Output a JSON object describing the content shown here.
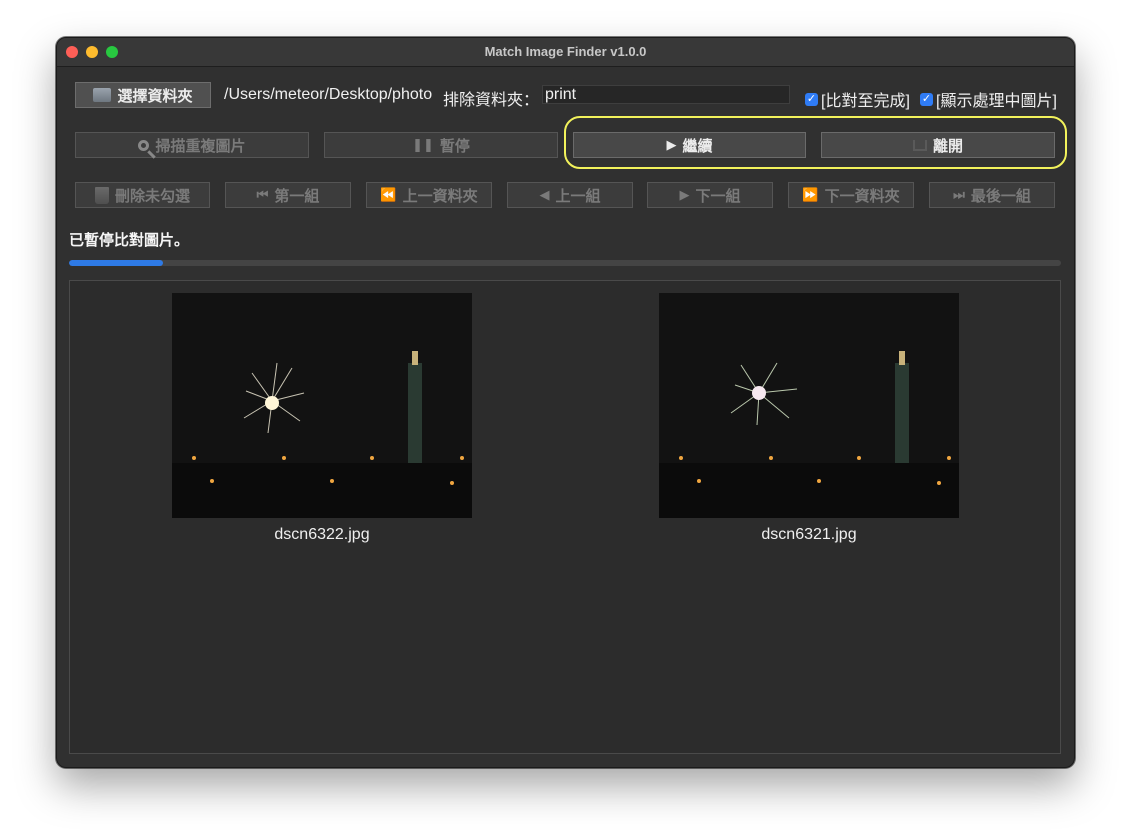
{
  "window": {
    "title": "Match Image Finder v1.0.0"
  },
  "toolbar": {
    "choose_folder_label": "選擇資料夾",
    "folder_path": "/Users/meteor/Desktop/photo",
    "exclude_label": "排除資料夾：",
    "exclude_value": "print",
    "compare_to_end_label": "[比對至完成]",
    "compare_to_end_checked": true,
    "show_processing_label": "[顯示處理中圖片]",
    "show_processing_checked": true
  },
  "actions": {
    "scan_label": "掃描重複圖片",
    "pause_label": "暫停",
    "continue_label": "繼續",
    "exit_label": "離開"
  },
  "nav": {
    "delete_unchecked_label": "刪除未勾選",
    "first_group_label": "第一組",
    "prev_folder_label": "上一資料夾",
    "prev_group_label": "上一組",
    "next_group_label": "下一組",
    "next_folder_label": "下一資料夾",
    "last_group_label": "最後一組"
  },
  "status": {
    "text": "已暫停比對圖片。",
    "progress": 0.095
  },
  "images": [
    {
      "filename": "dscn6322.jpg"
    },
    {
      "filename": "dscn6321.jpg"
    }
  ],
  "colors": {
    "accent": "#2e7ae6",
    "highlight": "#f2f25b"
  }
}
